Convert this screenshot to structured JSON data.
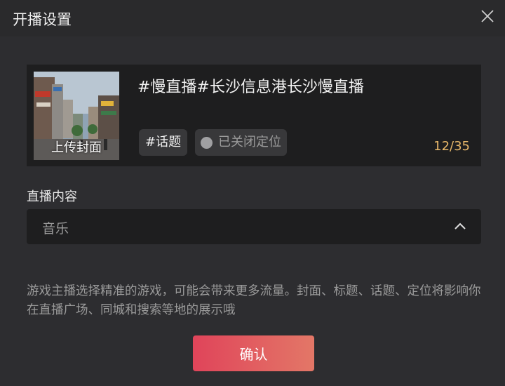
{
  "dialog": {
    "title": "开播设置",
    "close_icon": "close-icon"
  },
  "stream_card": {
    "cover_label": "上传封面",
    "live_title": "#慢直播#长沙信息港长沙慢直播",
    "topic_tag": "#话题",
    "location_label": "已关闭定位",
    "char_counter": "12/35"
  },
  "live_content": {
    "label": "直播内容",
    "selected_value": "音乐",
    "chevron_icon": "chevron-up-icon"
  },
  "hint_text": "游戏主播选择精准的游戏，可能会带来更多流量。封面、标题、话题、定位将影响你在直播广场、同城和搜索等地的展示哦",
  "confirm_label": "确认",
  "colors": {
    "background": "#2d2d30",
    "card": "#1e1e1f",
    "counter": "#e8b86a",
    "button_start": "#e0445a",
    "button_end": "#e37767"
  }
}
